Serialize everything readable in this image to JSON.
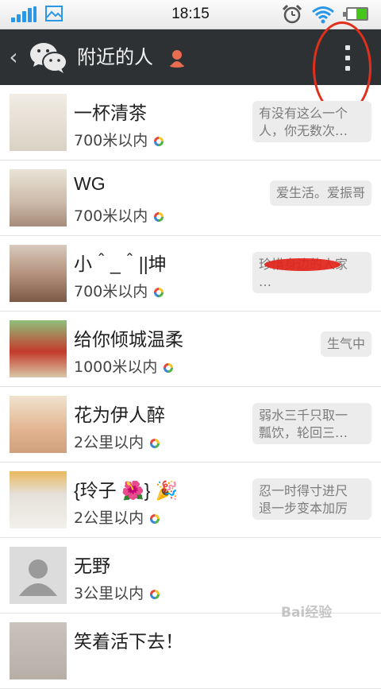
{
  "status_bar": {
    "time": "18:15",
    "icons": [
      "signal-icon",
      "photo-icon",
      "alarm-icon",
      "wifi-icon",
      "battery-icon"
    ],
    "battery_level": 0.55
  },
  "header": {
    "back_icon": "chevron-left-icon",
    "logo_icon": "wechat-logo-icon",
    "title": "附近的人",
    "title_icon": "person-marker-icon",
    "menu_icon": "more-vertical-icon"
  },
  "people": [
    {
      "name": "一杯清茶",
      "distance": "700米以内",
      "signature": "有没有这么一个\n人，你无数次…"
    },
    {
      "name": "WG",
      "distance": "700米以内",
      "signature": "爱生活。爱振哥"
    },
    {
      "name": "小＾_＾||坤",
      "distance": "700米以内",
      "signature": "珍惜身边的人家\n…"
    },
    {
      "name": "给你倾城温柔",
      "distance": "1000米以内",
      "signature": "生气中"
    },
    {
      "name": "花为伊人醉",
      "distance": "2公里以内",
      "signature": "弱水三千只取一\n瓢饮，轮回三…"
    },
    {
      "name": "{玲子 🌺} 🎉",
      "distance": "2公里以内",
      "signature": "忍一时得寸进尺\n退一步变本加厉"
    },
    {
      "name": "无野",
      "distance": "3公里以内",
      "signature": ""
    },
    {
      "name": "笑着活下去！",
      "distance": "",
      "signature": ""
    }
  ],
  "watermark": {
    "text": "Bai经验"
  },
  "colors": {
    "title_bar_bg": "#2e3133",
    "annotation_red": "#e0301c",
    "signal_blue": "#2b97e8",
    "battery_green": "#46c51a"
  }
}
